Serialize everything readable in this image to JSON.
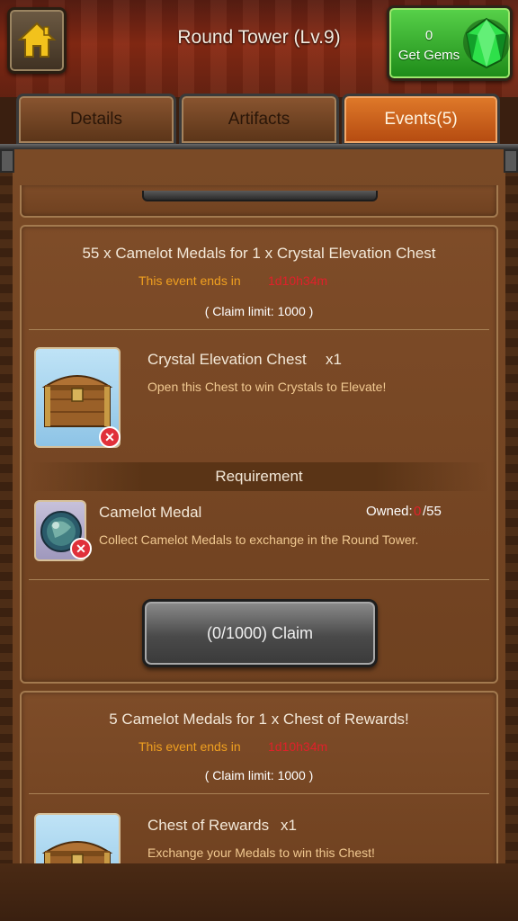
{
  "header": {
    "title": "Round Tower (Lv.9)",
    "gems": {
      "count": "0",
      "label": "Get Gems"
    }
  },
  "tabs": [
    {
      "label": "Details",
      "active": false
    },
    {
      "label": "Artifacts",
      "active": false
    },
    {
      "label": "Events(5)",
      "active": true
    }
  ],
  "events": [
    {
      "title": "55 x Camelot Medals for 1 x Crystal Elevation Chest",
      "ends_label": "This event ends in",
      "ends_time": "1d10h34m",
      "claim_limit": "( Claim limit: 1000 )",
      "reward": {
        "name": "Crystal Elevation Chest",
        "qty": "x1",
        "desc": "Open this Chest to win Crystals to Elevate!"
      },
      "requirement": {
        "heading": "Requirement",
        "name": "Camelot Medal",
        "owned_label": "Owned:",
        "owned_have": "0",
        "owned_need": "/55",
        "desc": "Collect Camelot Medals to exchange in the Round Tower."
      },
      "claim_button": "(0/1000)  Claim"
    },
    {
      "title": "5 Camelot Medals for 1 x Chest of Rewards!",
      "ends_label": "This event ends in",
      "ends_time": "1d10h34m",
      "claim_limit": "( Claim limit: 1000 )",
      "reward": {
        "name": "Chest of Rewards",
        "qty": "x1",
        "desc": "Exchange your Medals to win this Chest!"
      }
    }
  ],
  "colors": {
    "accent_orange": "#e07a2a",
    "gems_green": "#1d8a18",
    "time_red": "#e0202a",
    "ends_orange": "#f0a020"
  },
  "icons": {
    "home": "home-icon",
    "gem": "green-gem-icon",
    "chest": "treasure-chest-icon",
    "medal": "camelot-medal-icon",
    "remove": "remove-x-icon"
  }
}
